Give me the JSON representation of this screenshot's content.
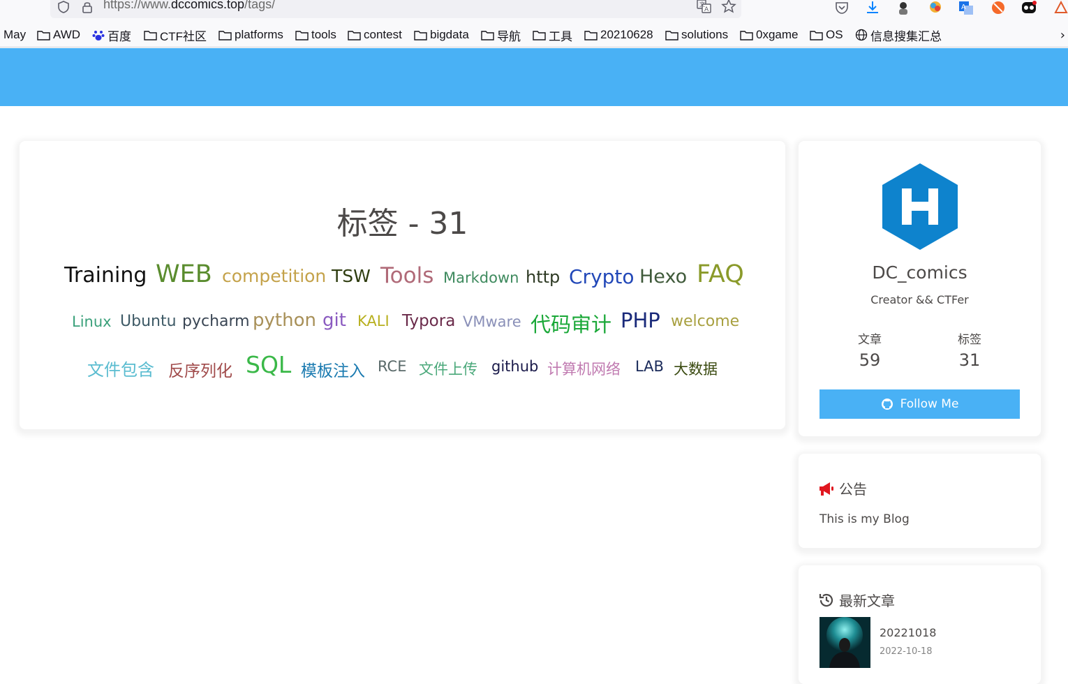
{
  "browser": {
    "url_prefix": "https://www.",
    "url_domain": "dccomics.top",
    "url_path": "/tags/",
    "bookmarks": [
      {
        "label": "May",
        "icon": "none"
      },
      {
        "label": "AWD",
        "icon": "folder-icon"
      },
      {
        "label": "百度",
        "icon": "baidu-icon"
      },
      {
        "label": "CTF社区",
        "icon": "folder-icon"
      },
      {
        "label": "platforms",
        "icon": "folder-icon"
      },
      {
        "label": "tools",
        "icon": "folder-icon"
      },
      {
        "label": "contest",
        "icon": "folder-icon"
      },
      {
        "label": "bigdata",
        "icon": "folder-icon"
      },
      {
        "label": "导航",
        "icon": "folder-icon"
      },
      {
        "label": "工具",
        "icon": "folder-icon"
      },
      {
        "label": "20210628",
        "icon": "folder-icon"
      },
      {
        "label": "solutions",
        "icon": "folder-icon"
      },
      {
        "label": "0xgame",
        "icon": "folder-icon"
      },
      {
        "label": "OS",
        "icon": "folder-icon"
      },
      {
        "label": "信息搜集汇总",
        "icon": "globe-icon"
      }
    ],
    "bookmarks_more": "›"
  },
  "page": {
    "title": "标签 - 31",
    "tags": [
      {
        "label": "Training",
        "color": "#111111"
      },
      {
        "label": "WEB",
        "color": "#5a8c2e"
      },
      {
        "label": "competition",
        "color": "#c4a24a"
      },
      {
        "label": "TSW",
        "color": "#2f3d10"
      },
      {
        "label": "Tools",
        "color": "#b06a78"
      },
      {
        "label": "Markdown",
        "color": "#3e8a5e"
      },
      {
        "label": "http",
        "color": "#2e3a24"
      },
      {
        "label": "Crypto",
        "color": "#2248b8"
      },
      {
        "label": "Hexo",
        "color": "#3f5a3a"
      },
      {
        "label": "FAQ",
        "color": "#8a9a2a"
      },
      {
        "label": "Linux",
        "color": "#3aa07a"
      },
      {
        "label": "Ubuntu",
        "color": "#3e5a66"
      },
      {
        "label": "pycharm",
        "color": "#3a4654"
      },
      {
        "label": "python",
        "color": "#a89058"
      },
      {
        "label": "git",
        "color": "#8a5ac0"
      },
      {
        "label": "KALI",
        "color": "#b8b020"
      },
      {
        "label": "Typora",
        "color": "#6a2a4a"
      },
      {
        "label": "VMware",
        "color": "#8a90b8"
      },
      {
        "label": "代码审计",
        "color": "#1aa838"
      },
      {
        "label": "PHP",
        "color": "#1a2a7a"
      },
      {
        "label": "welcome",
        "color": "#a8a040"
      },
      {
        "label": "文件包含",
        "color": "#5abcd0"
      },
      {
        "label": "反序列化",
        "color": "#a04a4a"
      },
      {
        "label": "SQL",
        "color": "#3ab848"
      },
      {
        "label": "模板注入",
        "color": "#1a7ab0"
      },
      {
        "label": "RCE",
        "color": "#5a6a6a"
      },
      {
        "label": "文件上传",
        "color": "#4aa87a"
      },
      {
        "label": "github",
        "color": "#1a1a4a"
      },
      {
        "label": "计算机网络",
        "color": "#c07ab0"
      },
      {
        "label": "LAB",
        "color": "#1a2a5a"
      },
      {
        "label": "大数据",
        "color": "#3a4a10"
      }
    ]
  },
  "sidebar": {
    "author_name": "DC_comics",
    "author_desc": "Creator && CTFer",
    "stats": [
      {
        "label": "文章",
        "value": "59"
      },
      {
        "label": "标签",
        "value": "31"
      }
    ],
    "follow_label": "Follow Me",
    "announcement_title": "公告",
    "announcement_text": "This is my Blog",
    "recent_title": "最新文章",
    "recent_posts": [
      {
        "title": "20221018",
        "date": "2022-10-18"
      }
    ]
  },
  "colors": {
    "accent": "#49b1f5",
    "hexo_blue": "#0e83cd",
    "announce_red": "#e0171f"
  }
}
